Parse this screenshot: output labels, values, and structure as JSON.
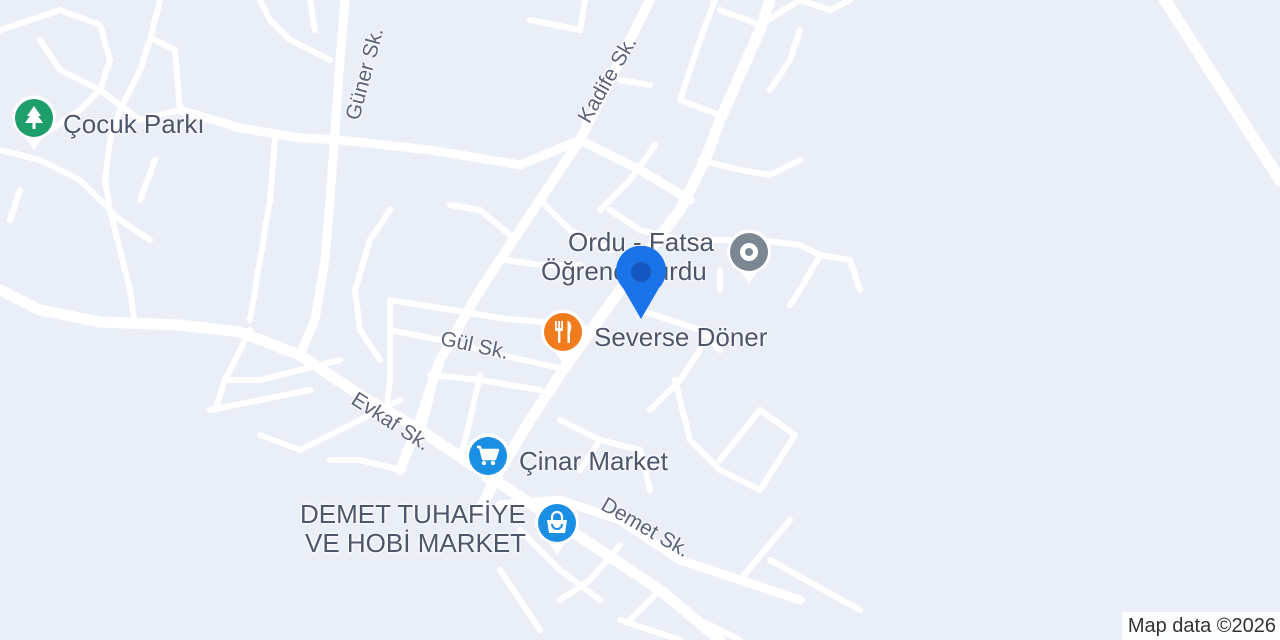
{
  "map": {
    "background": "#e9eef7",
    "road_color": "#ffffff",
    "streets": [
      {
        "id": "guner",
        "name": "Güner Sk."
      },
      {
        "id": "kadife",
        "name": "Kadife Sk."
      },
      {
        "id": "gul",
        "name": "Gül Sk."
      },
      {
        "id": "evkaf",
        "name": "Evkaf Sk."
      },
      {
        "id": "demet",
        "name": "Demet Sk."
      }
    ],
    "pois": [
      {
        "id": "cocuk-parki",
        "name": "Çocuk Parkı",
        "category": "park",
        "icon": "tree-icon",
        "color": "#1e9e6a"
      },
      {
        "id": "ordu-fatsa",
        "line1": "Ordu - Fatsa",
        "line2": "Öğrenci Yurdu",
        "category": "place",
        "icon": "place-icon",
        "color": "#7b8894"
      },
      {
        "id": "severse-doner",
        "name": "Severse Döner",
        "category": "restaurant",
        "icon": "fork-knife-icon",
        "color": "#f07c1e"
      },
      {
        "id": "cinar-market",
        "name": "Çinar Market",
        "category": "grocery",
        "icon": "shopping-cart-icon",
        "color": "#1a8fe3"
      },
      {
        "id": "demet-tuhafiye",
        "line1": "DEMET TUHAFİYE",
        "line2": "VE HOBİ MARKET",
        "category": "shopping",
        "icon": "shopping-bag-icon",
        "color": "#1a8fe3"
      }
    ],
    "location_marker": {
      "icon": "location-pin-icon",
      "color": "#1a73e8"
    },
    "attribution": "Map data ©2026"
  }
}
